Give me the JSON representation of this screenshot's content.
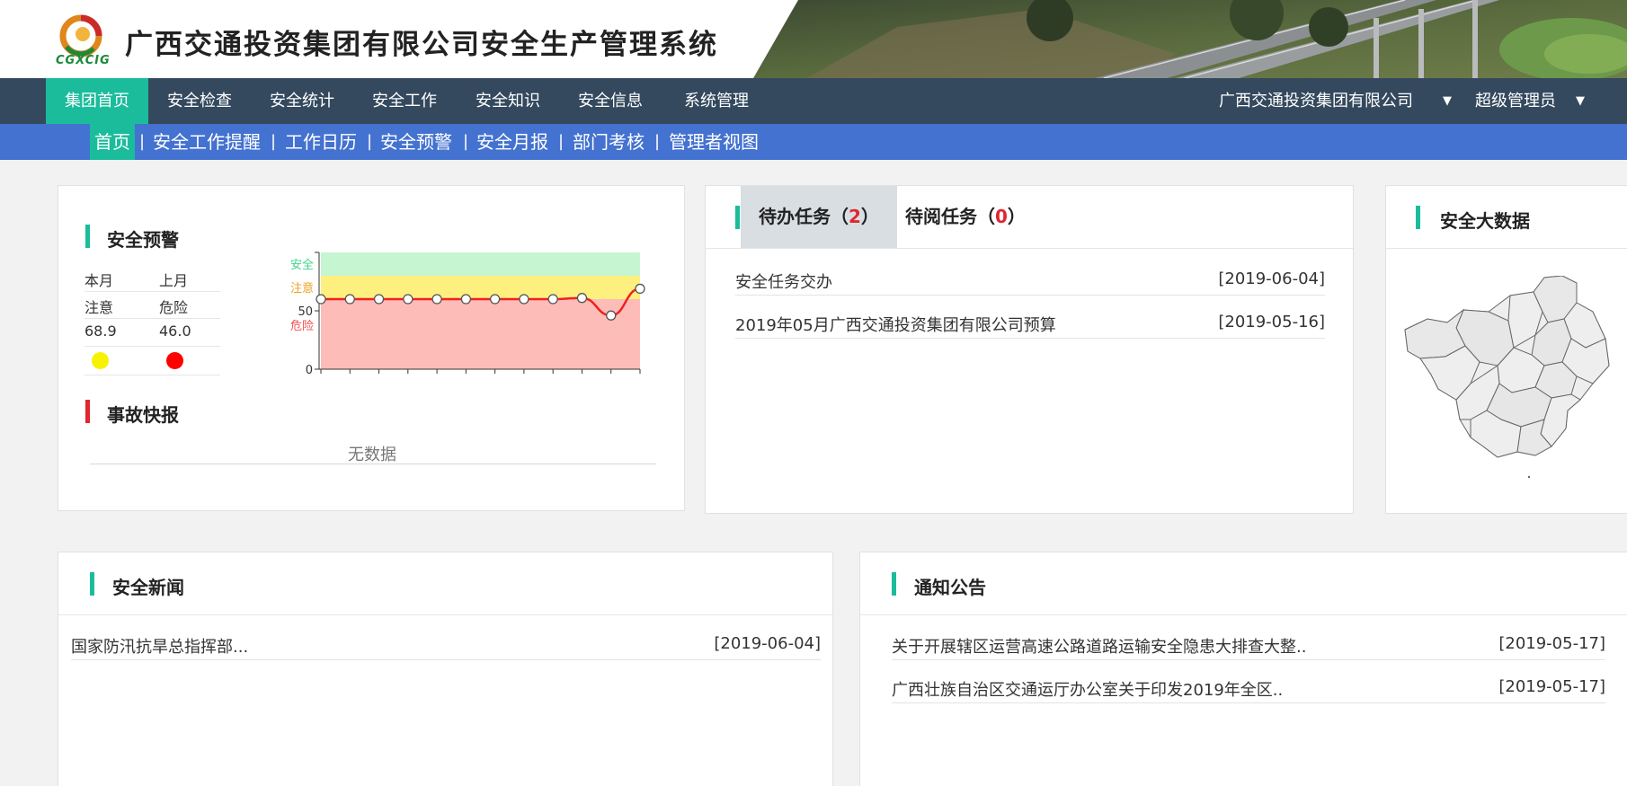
{
  "header": {
    "logo_text": "CGXCIG",
    "title": "广西交通投资集团有限公司安全生产管理系统"
  },
  "main_nav": {
    "items": [
      {
        "label": "集团首页",
        "active": true
      },
      {
        "label": "安全检查"
      },
      {
        "label": "安全统计"
      },
      {
        "label": "安全工作"
      },
      {
        "label": "安全知识"
      },
      {
        "label": "安全信息"
      },
      {
        "label": "系统管理"
      }
    ],
    "company": "广西交通投资集团有限公司",
    "user": "超级管理员",
    "caret": "▼"
  },
  "sub_nav": {
    "items": [
      {
        "label": "首页",
        "active": true
      },
      {
        "label": "安全工作提醒"
      },
      {
        "label": "工作日历"
      },
      {
        "label": "安全预警"
      },
      {
        "label": "安全月报"
      },
      {
        "label": "部门考核"
      },
      {
        "label": "管理者视图"
      }
    ],
    "separator": "|"
  },
  "warning": {
    "title": "安全预警",
    "table": {
      "headers": [
        "本月",
        "上月"
      ],
      "status": [
        "注意",
        "危险"
      ],
      "scores": [
        "68.9",
        "46.0"
      ],
      "dot_colors": [
        "#f7f200",
        "#ff0000"
      ]
    },
    "accident_title": "事故快报",
    "no_data": "无数据"
  },
  "chart_data": {
    "type": "line",
    "y_ticks": [
      "0",
      "50"
    ],
    "ylim": [
      0,
      100
    ],
    "bands": [
      {
        "label": "安全",
        "from": 80,
        "to": 100,
        "color": "#c6f5d2",
        "label_color": "#3dd68c"
      },
      {
        "label": "注意",
        "from": 60,
        "to": 80,
        "color": "#fdf07e",
        "label_color": "#f0a020"
      },
      {
        "label": "危险",
        "from": 0,
        "to": 60,
        "color": "#fdbcb8",
        "label_color": "#f05050"
      }
    ],
    "series": [
      {
        "values": [
          60,
          60,
          60,
          60,
          60,
          60,
          60,
          60,
          60,
          61,
          46,
          68.9
        ],
        "color": "#f02020"
      }
    ]
  },
  "tasks": {
    "tabs": [
      {
        "label": "待办任务",
        "count": "2",
        "active": true
      },
      {
        "label": "待阅任务",
        "count": "0"
      }
    ],
    "items": [
      {
        "title": "安全任务交办",
        "date": "[2019-06-04]"
      },
      {
        "title": "2019年05月广西交通投资集团有限公司预算",
        "date": "[2019-05-16]"
      }
    ]
  },
  "big_data": {
    "title": "安全大数据"
  },
  "news": {
    "title": "安全新闻",
    "items": [
      {
        "title": "国家防汛抗旱总指挥部...",
        "date": "[2019-06-04]"
      }
    ]
  },
  "notices": {
    "title": "通知公告",
    "items": [
      {
        "title": "关于开展辖区运营高速公路道路运输安全隐患大排查大整..",
        "date": "[2019-05-17]"
      },
      {
        "title": "广西壮族自治区交通运厅办公室关于印发2019年全区..",
        "date": "[2019-05-17]"
      }
    ]
  }
}
